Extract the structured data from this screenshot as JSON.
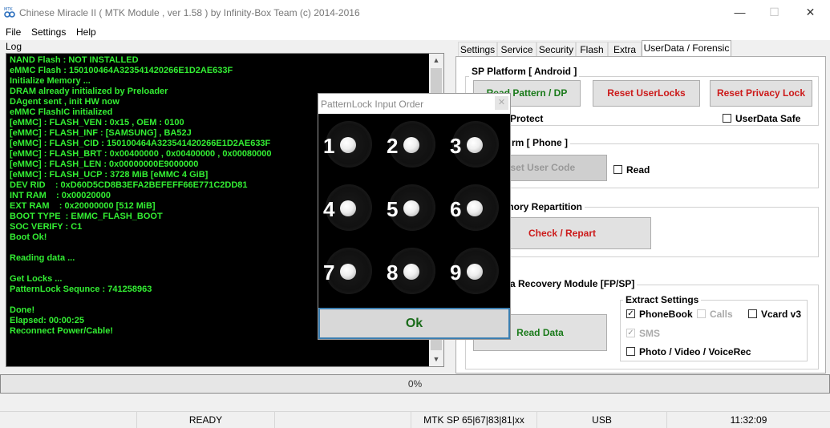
{
  "window": {
    "title": "Chinese Miracle II ( MTK Module , ver 1.58 ) by Infinity-Box Team (c) 2014-2016",
    "minimize": "—",
    "maximize": "☐",
    "close": "✕"
  },
  "menu": [
    "File",
    "Settings",
    "Help"
  ],
  "log": {
    "label": "Log",
    "lines": [
      "NAND Flash : NOT INSTALLED",
      "eMMC Flash : 150100464A323541420266E1D2AE633F",
      "Initialize Memory ...",
      "DRAM already initialized by Preloader",
      "DAgent sent , init HW now",
      "eMMC FlashIC initialized",
      "[eMMC] : FLASH_VEN : 0x15 , OEM : 0100",
      "[eMMC] : FLASH_INF : [SAMSUNG] , BA52J",
      "[eMMC] : FLASH_CID : 150100464A323541420266E1D2AE633F",
      "[eMMC] : FLASH_BRT : 0x00400000 , 0x00400000 , 0x00080000",
      "[eMMC] : FLASH_LEN : 0x00000000E9000000",
      "[eMMC] : FLASH_UCP : 3728 MiB [eMMC 4 GiB]",
      "DEV RID    : 0xD60D5CD8B3EFA2BEFEFF66E771C2DD81",
      "INT RAM    : 0x00020000",
      "EXT RAM    : 0x20000000 [512 MiB]",
      "BOOT TYPE  : EMMC_FLASH_BOOT",
      "SOC VERIFY : C1",
      "Boot Ok!",
      "",
      "Reading data ...",
      "",
      "Get Locks ...",
      "PatternLock Sequnce : 741258963",
      "",
      "Done!",
      "Elapsed: 00:00:25",
      "Reconnect Power/Cable!"
    ]
  },
  "tabs": [
    "Settings",
    "Service",
    "Security",
    "Flash",
    "Extra",
    "UserData / Forensic"
  ],
  "userdata": {
    "sp_platform": {
      "title": "SP Platform [ Android ]",
      "read_pattern_btn": "Read Pattern / DP",
      "reset_userlocks_btn": "Reset UserLocks",
      "reset_privacy_btn": "Reset Privacy Lock",
      "protect_label": "Protect",
      "userdata_safe_label": "UserData Safe"
    },
    "phone_platform": {
      "title": "rm [ Phone ]",
      "reset_usercode_btn": "eset User Code",
      "read_label": "Read"
    },
    "repartition": {
      "title": "mory Repartition",
      "check_btn": "Check / Repart"
    },
    "recovery": {
      "title": "ta Recovery Module  [FP/SP]",
      "read_data_btn": "Read Data",
      "extract_title": "Extract Settings",
      "phonebook": "PhoneBook",
      "calls": "Calls",
      "vcard": "Vcard v3",
      "sms": "SMS",
      "photo": "Photo / Video / VoiceRec",
      "checkmark": "✓"
    }
  },
  "progress": {
    "value": 0,
    "label": "0%"
  },
  "statusbar": [
    "READY",
    "MTK SP 65|67|83|81|xx",
    "USB",
    "11:32:09"
  ],
  "dialog": {
    "title": "PatternLock Input Order",
    "close": "✕",
    "numbers": [
      "1",
      "2",
      "3",
      "4",
      "5",
      "6",
      "7",
      "8",
      "9"
    ],
    "ok": "Ok"
  }
}
